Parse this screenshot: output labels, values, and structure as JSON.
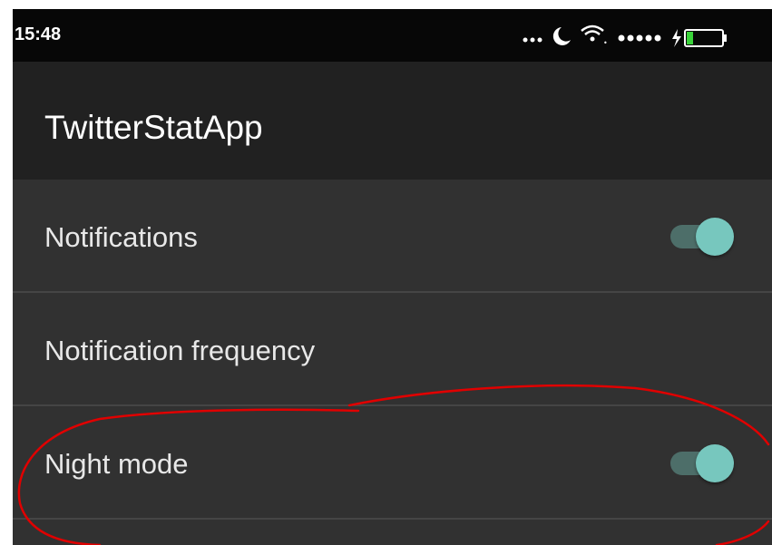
{
  "status_bar": {
    "time": "15:48",
    "icons": [
      "more-dots-icon",
      "moon-icon",
      "wifi-icon",
      "signal-dots-icon",
      "battery-charging-icon"
    ]
  },
  "app_bar": {
    "title": "TwitterStatApp"
  },
  "settings": [
    {
      "label": "Notifications",
      "has_toggle": true,
      "toggle_on": true
    },
    {
      "label": "Notification frequency",
      "has_toggle": false
    },
    {
      "label": "Night mode",
      "has_toggle": true,
      "toggle_on": true
    }
  ],
  "colors": {
    "background": "#313131",
    "app_bar": "#212121",
    "status_bar": "#070707",
    "toggle_thumb": "#77c7be",
    "toggle_track": "#4d6e69",
    "annotation": "#e00000"
  }
}
